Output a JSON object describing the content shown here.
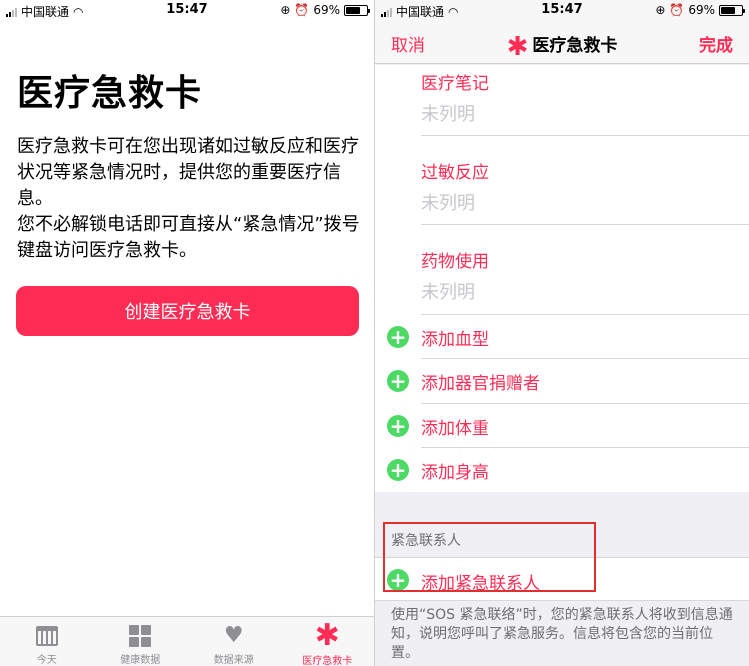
{
  "status": {
    "carrier": "中国联通",
    "time": "15:47",
    "battery": "69%",
    "battery_level": 0.69
  },
  "left": {
    "title": "医疗急救卡",
    "desc_line1": "医疗急救卡可在您出现诸如过敏反应和医疗状况等紧急情况时，提供您的重要医疗信息。",
    "desc_line2": "您不必解锁电话即可直接从“紧急情况”拨号键盘访问医疗急救卡。",
    "create_button": "创建医疗急救卡",
    "tabs": [
      {
        "label": "今天",
        "icon": "calendar-icon"
      },
      {
        "label": "健康数据",
        "icon": "grid-icon"
      },
      {
        "label": "数据来源",
        "icon": "heart-arrow-icon"
      },
      {
        "label": "医疗急救卡",
        "icon": "medical-asterisk-icon"
      }
    ]
  },
  "right": {
    "nav": {
      "cancel": "取消",
      "title": "医疗急救卡",
      "done": "完成"
    },
    "fields": [
      {
        "label": "医疗笔记",
        "value": "未列明"
      },
      {
        "label": "过敏反应",
        "value": "未列明"
      },
      {
        "label": "药物使用",
        "value": "未列明"
      }
    ],
    "add_rows": [
      "添加血型",
      "添加器官捐赠者",
      "添加体重",
      "添加身高"
    ],
    "section_header": "紧急联系人",
    "add_contact": "添加紧急联系人",
    "footer": "使用“SOS 紧急联络”时，您的紧急联系人将收到信息通知，说明您呼叫了紧急服务。信息将包含您的当前位置。"
  },
  "colors": {
    "accent": "#ff2d55",
    "button": "#fe2c55",
    "plus": "#4cd964",
    "highlight": "#e0302e"
  }
}
